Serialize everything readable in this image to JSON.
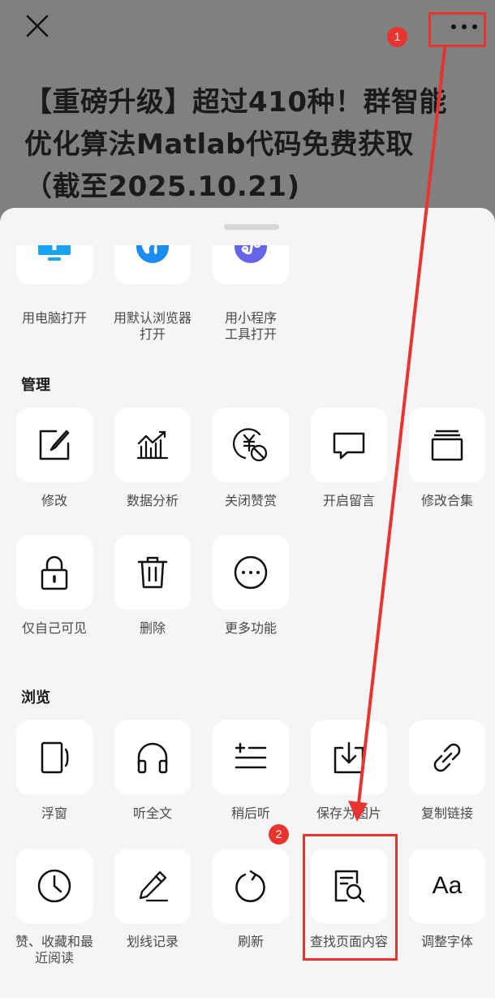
{
  "article": {
    "title_lines": [
      "【重磅升级】超过410种！群智能",
      "优化算法Matlab代码免费获取",
      "（截至2025.10.21)"
    ]
  },
  "annotations": {
    "badge_1": "1",
    "badge_2": "2",
    "color": "#e8332f"
  },
  "sheet": {
    "open_row": [
      {
        "label_lines": [
          "用电脑打开"
        ],
        "icon": "desktop-computer-icon"
      },
      {
        "label_lines": [
          "用默认浏览器",
          "打开"
        ],
        "icon": "globe-icon"
      },
      {
        "label_lines": [
          "用小程序",
          "工具打开"
        ],
        "icon": "mini-program-icon"
      }
    ],
    "manage": {
      "title": "管理",
      "items": [
        {
          "label": "修改",
          "icon": "edit-icon"
        },
        {
          "label": "数据分析",
          "icon": "data-analysis-icon"
        },
        {
          "label": "关闭赞赏",
          "icon": "close-appreciation-icon"
        },
        {
          "label": "开启留言",
          "icon": "comment-icon"
        },
        {
          "label": "修改合集",
          "icon": "collection-icon"
        },
        {
          "label": "仅自己可见",
          "icon": "lock-icon"
        },
        {
          "label": "删除",
          "icon": "trash-icon"
        },
        {
          "label": "更多功能",
          "icon": "more-functions-icon"
        }
      ]
    },
    "browse": {
      "title": "浏览",
      "items": [
        {
          "label_lines": [
            "浮窗"
          ],
          "icon": "floating-window-icon"
        },
        {
          "label_lines": [
            "听全文"
          ],
          "icon": "headphones-icon"
        },
        {
          "label_lines": [
            "稍后听"
          ],
          "icon": "listen-later-icon"
        },
        {
          "label_lines": [
            "保存为图片"
          ],
          "icon": "save-image-icon"
        },
        {
          "label_lines": [
            "复制链接"
          ],
          "icon": "link-icon"
        },
        {
          "label_lines": [
            "赞、收藏和最",
            "近阅读"
          ],
          "icon": "clock-icon"
        },
        {
          "label_lines": [
            "划线记录"
          ],
          "icon": "pen-icon"
        },
        {
          "label_lines": [
            "刷新"
          ],
          "icon": "refresh-icon"
        },
        {
          "label_lines": [
            "查找页面内容"
          ],
          "icon": "find-in-page-icon"
        },
        {
          "label_lines": [
            "调整字体"
          ],
          "icon": "font-size-icon"
        }
      ]
    },
    "font_icon_text": "Aa"
  }
}
